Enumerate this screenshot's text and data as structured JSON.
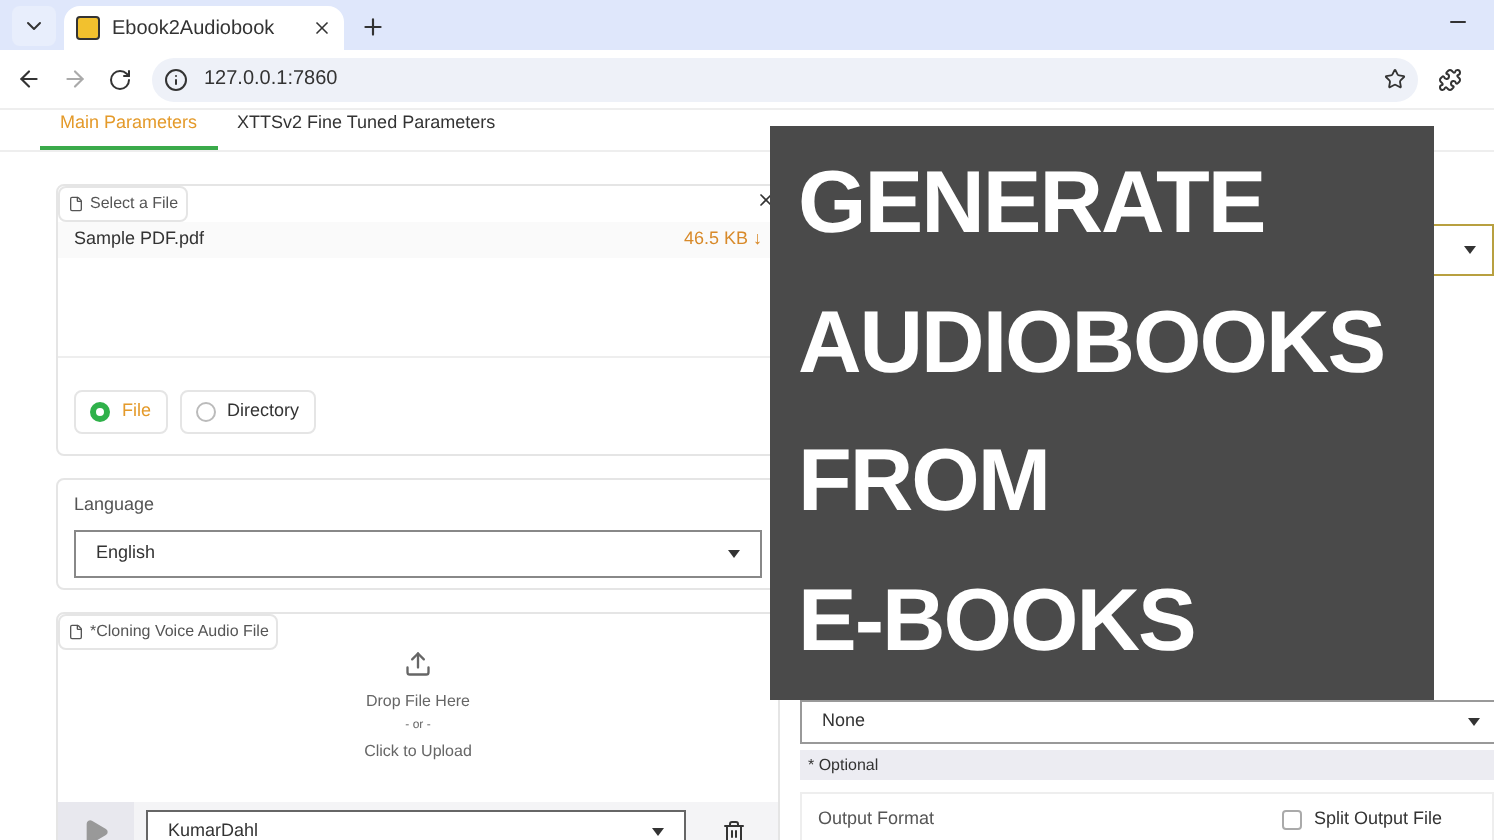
{
  "browser": {
    "tab_title": "Ebook2Audiobook",
    "url": "127.0.0.1:7860"
  },
  "tabs": [
    {
      "label": "Main Parameters",
      "selected": true
    },
    {
      "label": "XTTSv2 Fine Tuned Parameters",
      "selected": false
    }
  ],
  "file_input": {
    "label": "Select a File",
    "file_name": "Sample PDF.pdf",
    "file_size": "46.5 KB ↓"
  },
  "mode": [
    {
      "label": "File",
      "selected": true
    },
    {
      "label": "Directory",
      "selected": false
    }
  ],
  "language": {
    "label": "Language",
    "value": "English"
  },
  "voice_file": {
    "label": "*Cloning Voice Audio File",
    "drop": "Drop File Here",
    "or": "- or -",
    "click": "Click to Upload",
    "voice": "KumarDahl"
  },
  "right": {
    "custom_model": "None",
    "note": "* Optional",
    "output_format": "Output Format",
    "split": {
      "label": "Split Output File",
      "checked": false
    }
  },
  "overlay": {
    "lines": [
      "GENERATE",
      "AUDIOBOOKS",
      "FROM",
      "E-BOOKS"
    ]
  }
}
